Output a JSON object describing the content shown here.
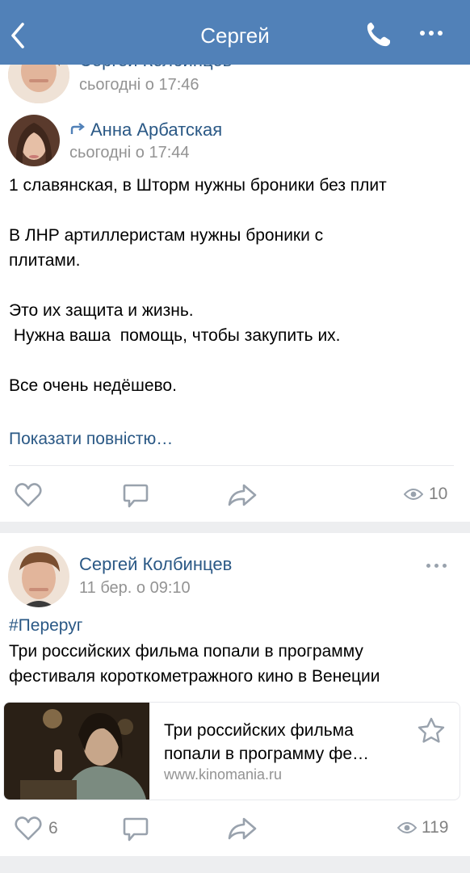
{
  "header": {
    "title": "Сергей"
  },
  "post1": {
    "author": "Сергей Колбинцев",
    "time": "сьогодні о 17:46",
    "repost": {
      "author": "Анна Арбатская",
      "time": "сьогодні о 17:44"
    },
    "text": "1 славянская, в Шторм нужны броники без плит\n\nВ ЛНР артиллеристам нужны броники с\nплитами.\n\nЭто их защита и жизнь.\n Нужна ваша  помощь, чтобы закупить их.\n\nВсе очень недёшево.",
    "show_more": "Показати повністю…",
    "views": "10"
  },
  "post2": {
    "author": "Сергей Колбинцев",
    "time": "11 бер. о 09:10",
    "hashtag": "#Переруг",
    "text": "Три российских фильма попали в программу\nфестиваля короткометражного кино в Венеции",
    "card": {
      "title": "Три российских фильма\nпопали в программу фе…",
      "domain": "www.kinomania.ru"
    },
    "likes": "6",
    "views": "119"
  },
  "icons": {
    "back": "chevron-left-icon",
    "call": "phone-icon",
    "more": "more-dots-icon",
    "repost": "repost-arrow-icon",
    "like": "heart-icon",
    "comment": "comment-icon",
    "share": "share-icon",
    "views": "eye-icon",
    "bookmark": "star-icon"
  },
  "colors": {
    "navbar": "#5181b8",
    "link": "#2a5885",
    "secondary": "#939393",
    "icon": "#99a2ad",
    "background": "#edeef0"
  }
}
